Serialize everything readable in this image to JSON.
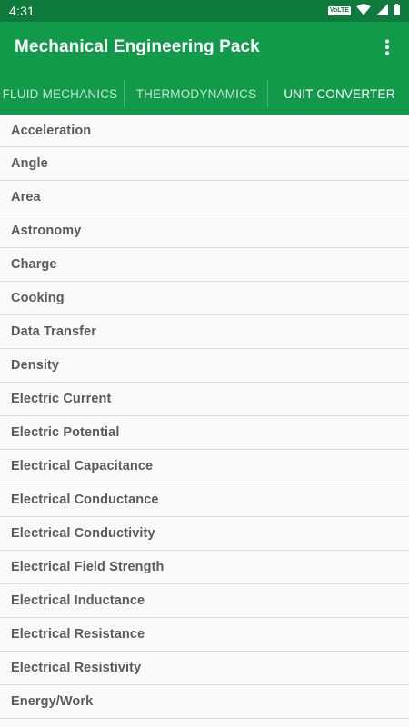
{
  "status_bar": {
    "time": "4:31",
    "volte_label": "VoLTE",
    "icons": [
      "volte-badge",
      "wifi-icon",
      "signal-icon",
      "battery-icon"
    ]
  },
  "app_bar": {
    "title": "Mechanical Engineering Pack",
    "menu_icon": "more-vert-icon"
  },
  "tabs": [
    {
      "label": "FLUID MECHANICS",
      "active": false
    },
    {
      "label": "THERMODYNAMICS",
      "active": false
    },
    {
      "label": "UNIT CONVERTER",
      "active": true
    }
  ],
  "list": {
    "items": [
      "Acceleration",
      "Angle",
      "Area",
      "Astronomy",
      "Charge",
      "Cooking",
      "Data Transfer",
      "Density",
      "Electric Current",
      "Electric Potential",
      "Electrical Capacitance",
      "Electrical Conductance",
      "Electrical Conductivity",
      "Electrical Field Strength",
      "Electrical Inductance",
      "Electrical Resistance",
      "Electrical Resistivity",
      "Energy/Work"
    ]
  },
  "colors": {
    "status_bar": "#0e7a3c",
    "primary": "#109a4a",
    "list_text": "#5a5a5a",
    "divider": "#dcdcdc"
  }
}
